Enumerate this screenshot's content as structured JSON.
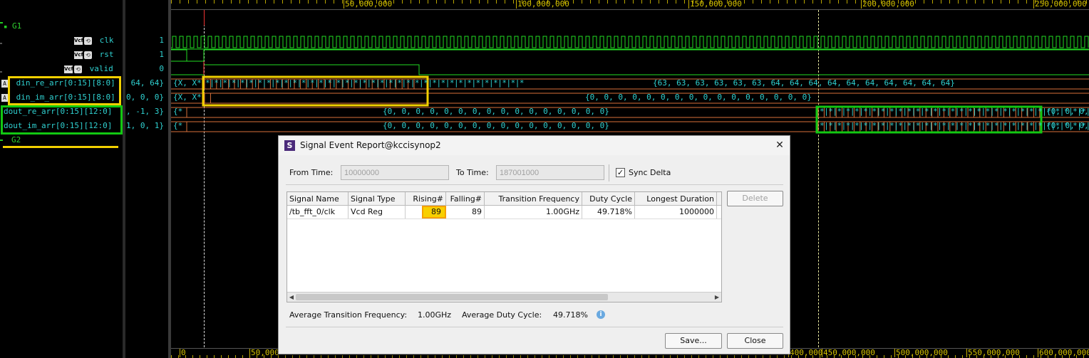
{
  "signals_panel": {
    "group1": "G1",
    "group2": "G2",
    "signals": [
      {
        "name": "clk",
        "value": "1",
        "badge": "Vcf"
      },
      {
        "name": "rst",
        "value": "1",
        "badge": "Vcf"
      },
      {
        "name": "valid",
        "value": "0",
        "badge": "Vcf"
      },
      {
        "name": "din_re_arr[0:15][8:0]",
        "value": "64, 64}",
        "badge": "A"
      },
      {
        "name": "din_im_arr[0:15][8:0]",
        "value": "0, 0, 0}",
        "badge": "A"
      },
      {
        "name": "dout_re_arr[0:15][12:0]",
        "value": ", -1, 3}"
      },
      {
        "name": "dout_im_arr[0:15][12:0]",
        "value": "1, 0, 1}"
      }
    ]
  },
  "timeline": {
    "top_ticks": [
      "50,000,000",
      "100,000,000",
      "150,000,000",
      "200,000,000",
      "250,000,000"
    ],
    "bottom_ticks": [
      "0",
      "50,000",
      "400,000",
      "450,000,000",
      "500,000,000",
      "550,000,000",
      "600,000,000"
    ]
  },
  "waveform_labels": {
    "din_re_prefix": "{X, X*",
    "din_re_value": "{63, 63, 63, 63, 63, 63, 64, 64, 64, 64, 64, 64, 64, 64, 64, 64}",
    "din_im_prefix": "{X, X*",
    "din_im_value": "{0, 0, 0, 0, 0, 0, 0, 0, 0, 0, 0, 0, 0, 0, 0, 0}",
    "dout_re_prefix": "{*",
    "dout_re_value": "{0, 0, 0, 0, 0, 0, 0, 0, 0, 0, 0, 0, 0, 0, 0, 0}",
    "dout_re_tail": "{0, 0, 0,",
    "dout_im_prefix": "{*",
    "dout_im_value": "{0, 0, 0, 0, 0, 0, 0, 0, 0, 0, 0, 0, 0, 0, 0, 0}",
    "dout_im_tail": "{0, 0, 0,"
  },
  "dialog": {
    "title": "Signal Event Report@kccisynop2",
    "app_icon": "S",
    "close_glyph": "✕",
    "from_time_label": "From Time:",
    "from_time_value": "10000000",
    "to_time_label": "To Time:",
    "to_time_value": "187001000",
    "sync_delta_label": "Sync Delta",
    "sync_delta_checked": true,
    "columns": [
      "Signal Name",
      "Signal Type",
      "Rising#",
      "Falling#",
      "Transition Frequency",
      "Duty Cycle",
      "Longest Duration"
    ],
    "rows": [
      {
        "signal_name": "/tb_fft_0/clk",
        "signal_type": "Vcd Reg",
        "rising": "89",
        "falling": "89",
        "transition_frequency": "1.00GHz",
        "duty_cycle": "49.718%",
        "longest_duration": "1000000"
      }
    ],
    "delete_label": "Delete",
    "avg_freq_label": "Average Transition Frequency:",
    "avg_freq_value": "1.00GHz",
    "avg_duty_label": "Average Duty Cycle:",
    "avg_duty_value": "49.718%",
    "save_label": "Save...",
    "close_label": "Close"
  },
  "colors": {
    "signal_text": "#2fd0d0",
    "wave_green": "#22dd22",
    "bus_orange": "#d8703a",
    "highlight_yellow": "#f2d000",
    "highlight_green": "#12c812",
    "tick_yellow": "#d6c300"
  }
}
